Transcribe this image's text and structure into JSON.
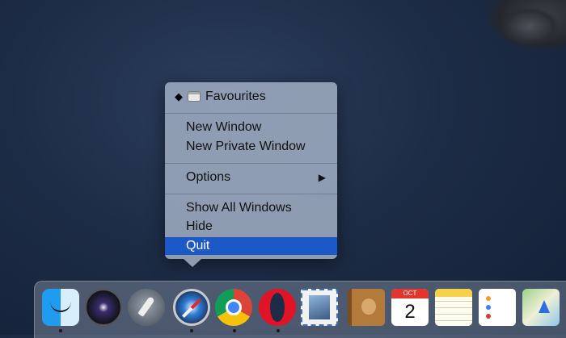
{
  "menu": {
    "favourites": {
      "marker": "◆",
      "label": "Favourites"
    },
    "items": [
      {
        "label": "New Window"
      },
      {
        "label": "New Private Window"
      },
      {
        "label": "Options",
        "submenu_glyph": "▶"
      },
      {
        "label": "Show All Windows"
      },
      {
        "label": "Hide"
      },
      {
        "label": "Quit",
        "highlighted": true
      }
    ],
    "highlight_color": "#1d58c7"
  },
  "dock": {
    "apps": [
      {
        "name": "Finder",
        "icon": "finder-icon",
        "running": true
      },
      {
        "name": "Siri",
        "icon": "siri-icon",
        "running": false
      },
      {
        "name": "Launchpad",
        "icon": "launchpad-icon",
        "running": false
      },
      {
        "name": "Safari",
        "icon": "safari-icon",
        "running": true
      },
      {
        "name": "Chrome",
        "icon": "chrome-icon",
        "running": true
      },
      {
        "name": "Opera",
        "icon": "opera-icon",
        "running": true
      },
      {
        "name": "Mail",
        "icon": "mail-icon",
        "running": false
      },
      {
        "name": "Contacts",
        "icon": "contacts-icon",
        "running": false
      },
      {
        "name": "Calendar",
        "icon": "calendar-icon",
        "running": false,
        "month": "OCT",
        "day": "2"
      },
      {
        "name": "Notes",
        "icon": "notes-icon",
        "running": false
      },
      {
        "name": "Reminders",
        "icon": "reminders-icon",
        "running": false
      },
      {
        "name": "Maps",
        "icon": "maps-icon",
        "running": false
      }
    ]
  }
}
